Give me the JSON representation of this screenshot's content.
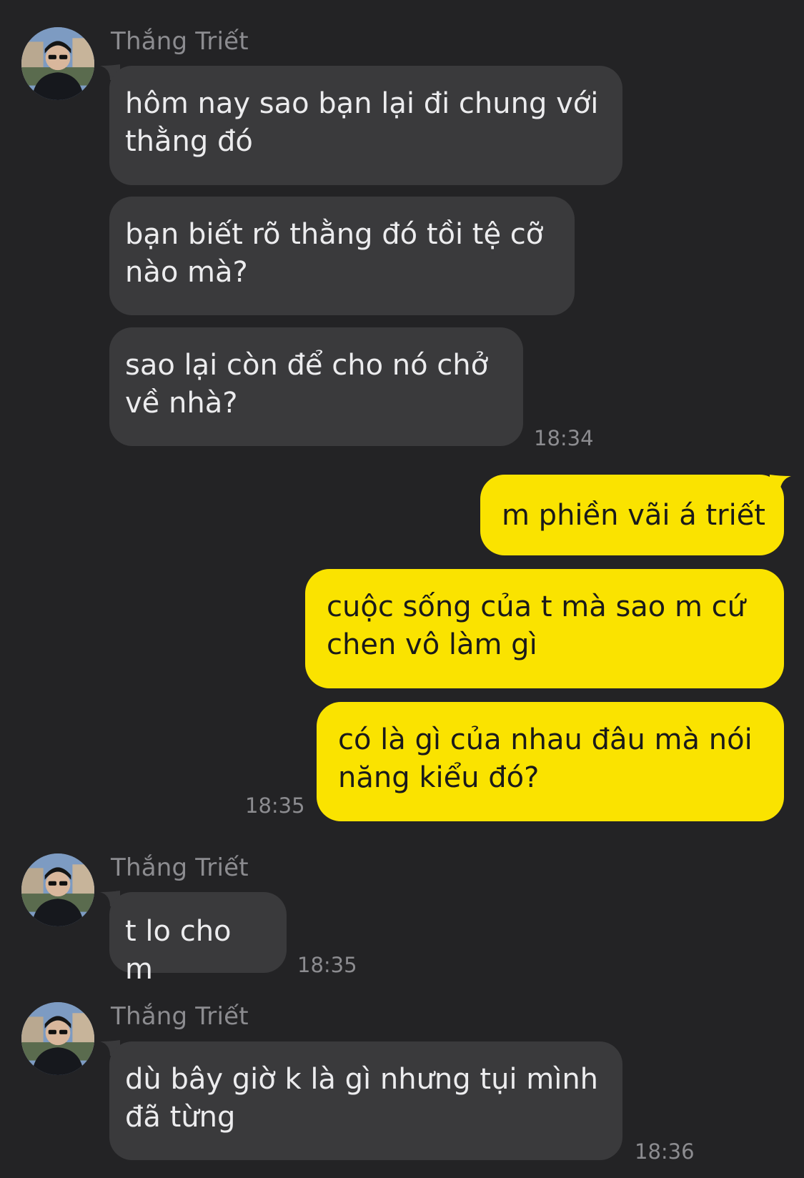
{
  "colors": {
    "background": "#232325",
    "incoming_bubble": "#3a3a3c",
    "outgoing_bubble": "#fae300",
    "incoming_text": "#ececee",
    "outgoing_text": "#1a1a1a",
    "meta_text": "#8c8c90"
  },
  "contact": {
    "name": "Thắng Triết",
    "avatar_icon": "profile-photo"
  },
  "messages": [
    {
      "dir": "in",
      "lines": [
        "hôm nay sao bạn lại đi chung với",
        "thằng đó"
      ]
    },
    {
      "dir": "in",
      "lines": [
        "bạn biết rõ thằng đó tồi tệ cỡ",
        "nào mà?"
      ]
    },
    {
      "dir": "in",
      "lines": [
        "sao lại còn để cho nó chở",
        "về nhà?"
      ],
      "time": "18:34"
    },
    {
      "dir": "out",
      "lines": [
        "m phiền vãi á triết"
      ]
    },
    {
      "dir": "out",
      "lines": [
        "cuộc sống của t mà sao m cứ",
        "chen vô làm gì"
      ]
    },
    {
      "dir": "out",
      "lines": [
        "có là gì của nhau đâu mà nói",
        "năng kiểu đó?"
      ],
      "time": "18:35"
    },
    {
      "dir": "in",
      "lines": [
        "t lo cho m"
      ],
      "time": "18:35"
    },
    {
      "dir": "in",
      "lines": [
        "dù bây giờ k là gì nhưng tụi mình",
        "đã từng"
      ],
      "time": "18:36"
    }
  ]
}
